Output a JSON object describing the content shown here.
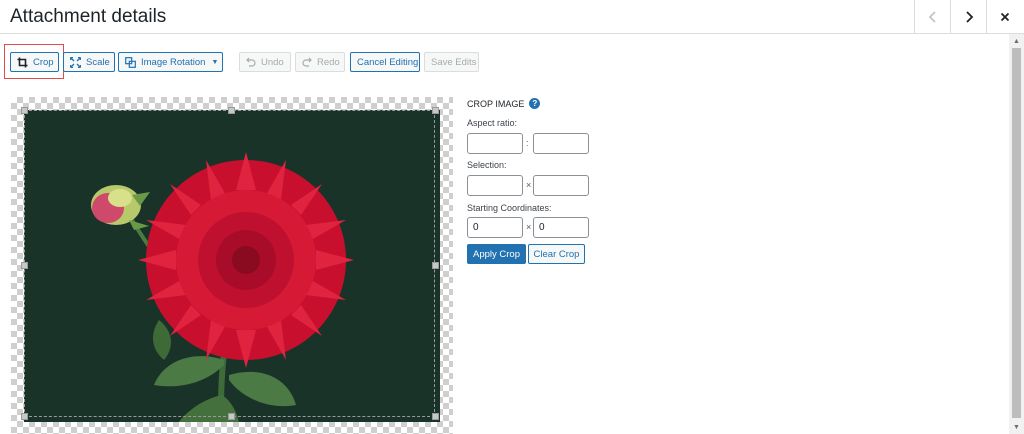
{
  "modal": {
    "title": "Attachment details",
    "prev_icon": "chevron-left-icon",
    "next_icon": "chevron-right-icon",
    "close_icon": "close-icon"
  },
  "toolbar": {
    "crop_label": "Crop",
    "scale_label": "Scale",
    "rotation_label": "Image Rotation",
    "undo_label": "Undo",
    "redo_label": "Redo",
    "cancel_label": "Cancel Editing",
    "save_label": "Save Edits"
  },
  "crop_panel": {
    "title": "Crop Image",
    "help_label": "?",
    "aspect_ratio_label": "Aspect ratio:",
    "aspect_sep": ":",
    "aspect_width_value": "",
    "aspect_height_value": "",
    "selection_label": "Selection:",
    "selection_sep": "×",
    "selection_width_value": "",
    "selection_height_value": "",
    "start_coords_label": "Starting Coordinates:",
    "coords_sep": "×",
    "start_x_value": "0",
    "start_y_value": "0",
    "apply_label": "Apply Crop",
    "clear_label": "Clear Crop"
  },
  "image": {
    "subject": "red-dahlia-flower",
    "background_color": "#1a3328"
  },
  "colors": {
    "accent": "#2271b1",
    "highlight": "#e04b4b"
  }
}
